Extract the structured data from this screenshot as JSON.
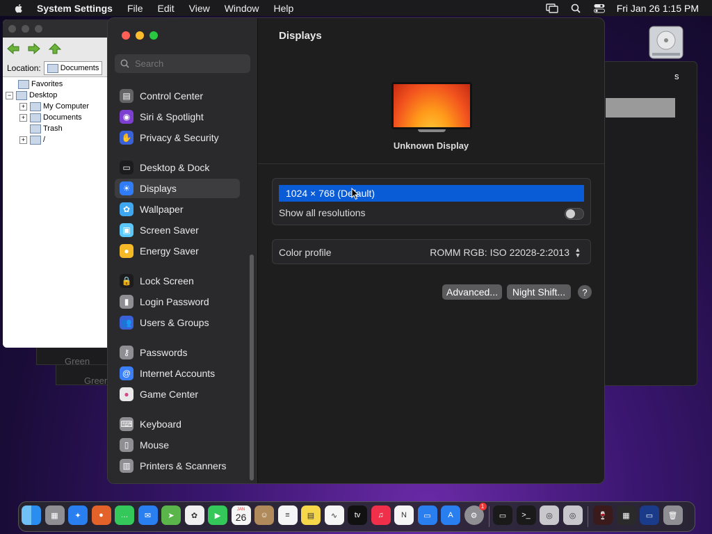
{
  "menubar": {
    "app_name": "System Settings",
    "items": [
      "File",
      "Edit",
      "View",
      "Window",
      "Help"
    ],
    "clock": "Fri Jan 26  1:15 PM"
  },
  "file_manager": {
    "location_label": "Location:",
    "location_value": "Documents",
    "tree": [
      {
        "label": "Favorites"
      },
      {
        "label": "Desktop"
      },
      {
        "label": "My Computer"
      },
      {
        "label": "Documents"
      },
      {
        "label": "Trash"
      },
      {
        "label": "/"
      }
    ]
  },
  "background": {
    "green_1": "Green",
    "green_2": "Green",
    "disk_label": "s"
  },
  "sidebar": {
    "search_placeholder": "Search",
    "items": [
      {
        "label": "Control Center",
        "icon": "control-center-icon",
        "color": "#636366"
      },
      {
        "label": "Siri & Spotlight",
        "icon": "siri-icon",
        "color": "#7d3fd1"
      },
      {
        "label": "Privacy & Security",
        "icon": "hand-icon",
        "color": "#3a62d8"
      },
      {
        "label": "Desktop & Dock",
        "icon": "dock-icon",
        "color": "#1c1c1e"
      },
      {
        "label": "Displays",
        "icon": "sun-icon",
        "color": "#2f7cf6"
      },
      {
        "label": "Wallpaper",
        "icon": "flower-icon",
        "color": "#3fa6f0"
      },
      {
        "label": "Screen Saver",
        "icon": "screen-saver-icon",
        "color": "#5ac8fa"
      },
      {
        "label": "Energy Saver",
        "icon": "bulb-icon",
        "color": "#f5b928"
      },
      {
        "label": "Lock Screen",
        "icon": "lock-icon",
        "color": "#1c1c1e"
      },
      {
        "label": "Login Password",
        "icon": "padlock-icon",
        "color": "#8e8e93"
      },
      {
        "label": "Users & Groups",
        "icon": "users-icon",
        "color": "#3a62d8"
      },
      {
        "label": "Passwords",
        "icon": "key-icon",
        "color": "#8e8e93"
      },
      {
        "label": "Internet Accounts",
        "icon": "at-icon",
        "color": "#3a7ff6"
      },
      {
        "label": "Game Center",
        "icon": "game-center-icon",
        "color": "#e9e9ea"
      },
      {
        "label": "Keyboard",
        "icon": "keyboard-icon",
        "color": "#8e8e93"
      },
      {
        "label": "Mouse",
        "icon": "mouse-icon",
        "color": "#8e8e93"
      },
      {
        "label": "Printers & Scanners",
        "icon": "printer-icon",
        "color": "#8e8e93"
      }
    ]
  },
  "main": {
    "title": "Displays",
    "display_name": "Unknown Display",
    "resolution_selected": "1024 × 768 (Default)",
    "show_all_label": "Show all resolutions",
    "color_profile_label": "Color profile",
    "color_profile_value": "ROMM RGB: ISO 22028-2:2013",
    "advanced_button": "Advanced...",
    "night_shift_button": "Night Shift...",
    "help_button": "?"
  },
  "dock": {
    "calendar_day": "26",
    "calendar_month": "JAN",
    "tv_label": "tv",
    "system_settings_badge": "1"
  },
  "colors": {
    "accent": "#0a5bd6",
    "selection": "#3d3d40"
  }
}
